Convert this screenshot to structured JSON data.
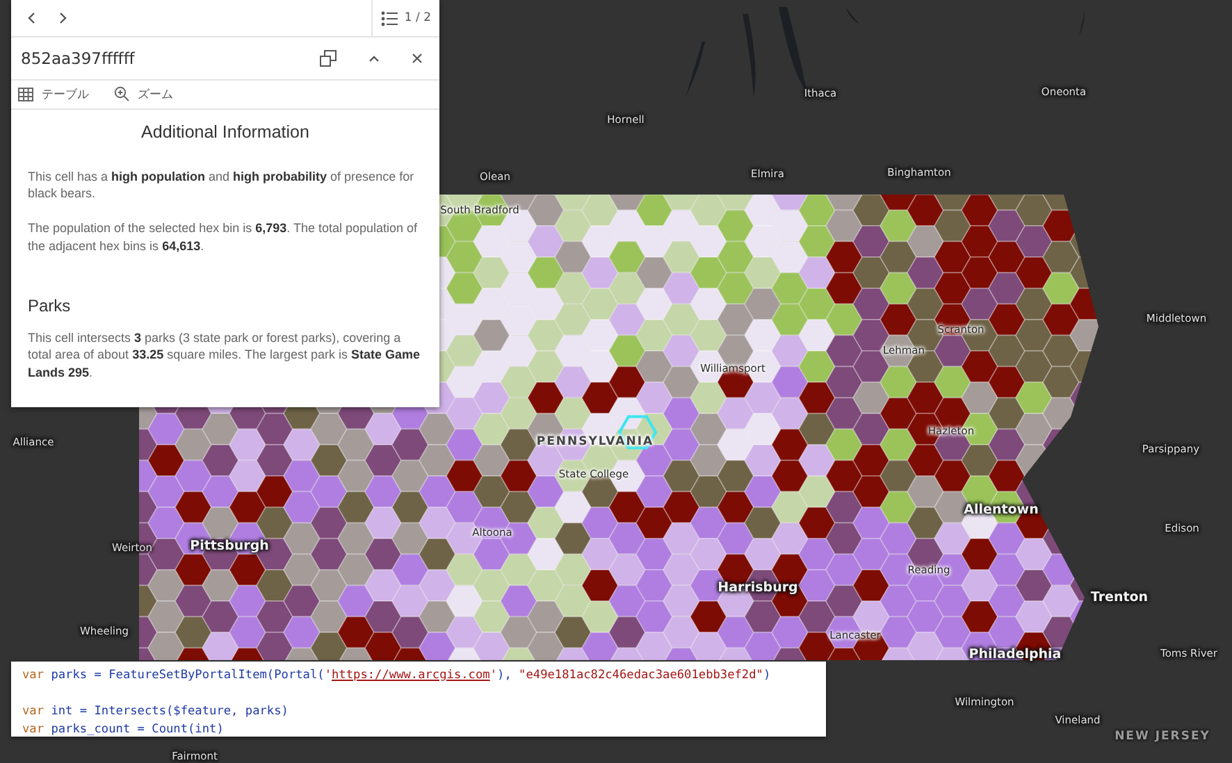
{
  "map": {
    "labels": [
      {
        "text": "Ithaca",
        "kind": "city"
      },
      {
        "text": "Oneonta",
        "kind": "city"
      },
      {
        "text": "Hornell",
        "kind": "city"
      },
      {
        "text": "Olean",
        "kind": "city"
      },
      {
        "text": "Elmira",
        "kind": "city"
      },
      {
        "text": "Binghamton",
        "kind": "city"
      },
      {
        "text": "South Bradford",
        "kind": "city"
      },
      {
        "text": "Middletown",
        "kind": "city"
      },
      {
        "text": "Scranton",
        "kind": "city"
      },
      {
        "text": "Lehman",
        "kind": "city"
      },
      {
        "text": "Williamsport",
        "kind": "city"
      },
      {
        "text": "Hazleton",
        "kind": "city"
      },
      {
        "text": "PENNSYLVANIA",
        "kind": "state"
      },
      {
        "text": "State College",
        "kind": "city"
      },
      {
        "text": "Alliance",
        "kind": "city"
      },
      {
        "text": "Parsippany",
        "kind": "city"
      },
      {
        "text": "Allentown",
        "kind": "major"
      },
      {
        "text": "Edison",
        "kind": "city"
      },
      {
        "text": "Altoona",
        "kind": "city"
      },
      {
        "text": "Pittsburgh",
        "kind": "major"
      },
      {
        "text": "Weirton",
        "kind": "city"
      },
      {
        "text": "Wheeling",
        "kind": "city"
      },
      {
        "text": "Harrisburg",
        "kind": "major"
      },
      {
        "text": "Reading",
        "kind": "city"
      },
      {
        "text": "Trenton",
        "kind": "major"
      },
      {
        "text": "Lancaster",
        "kind": "city"
      },
      {
        "text": "Philadelphia",
        "kind": "major"
      },
      {
        "text": "Toms River",
        "kind": "city"
      },
      {
        "text": "Wilmington",
        "kind": "city"
      },
      {
        "text": "Vineland",
        "kind": "city"
      },
      {
        "text": "Fairmont",
        "kind": "city"
      },
      {
        "text": "NEW JERSEY",
        "kind": "state"
      }
    ]
  },
  "popup": {
    "page_counter": "1 / 2",
    "title": "852aa397ffffff",
    "actions": [
      {
        "label": "テーブル",
        "kind": "table"
      },
      {
        "label": "ズーム",
        "kind": "zoom"
      }
    ],
    "sections": [
      {
        "heading": "Additional Information",
        "kind": "centered",
        "paragraphs": [
          "This cell has a **high population** and **high probability** of presence for black bears.",
          "The population of the selected hex bin is **6,793**. The total population of the adjacent hex bins is **64,613**."
        ]
      },
      {
        "heading": "Parks",
        "kind": "left",
        "paragraphs": [
          "This cell intersects **3** parks (3 state park or forest parks), covering a total area of about **33.25** square miles. The largest park is **State Game Lands 295**."
        ]
      }
    ]
  },
  "code": {
    "blocks": [
      [
        [
          {
            "text": "var",
            "kind": "keyword"
          },
          {
            "text": " parks = FeatureSetByPortalItem(Portal(",
            "kind": "ident"
          },
          {
            "text": "'",
            "kind": "string"
          },
          {
            "text": "https://www.arcgis.com",
            "kind": "url"
          },
          {
            "text": "'",
            "kind": "string"
          },
          {
            "text": "), ",
            "kind": "ident"
          },
          {
            "text": "\"e49e181ac82c46edac3ae601ebb3ef2d\"",
            "kind": "string"
          },
          {
            "text": ")",
            "kind": "ident"
          }
        ]
      ],
      [
        [
          {
            "text": "var",
            "kind": "keyword"
          },
          {
            "text": " int = Intersects($feature, parks)",
            "kind": "ident"
          }
        ],
        [
          {
            "text": "var",
            "kind": "keyword"
          },
          {
            "text": " parks_count = Count(int)",
            "kind": "ident"
          }
        ]
      ]
    ]
  }
}
